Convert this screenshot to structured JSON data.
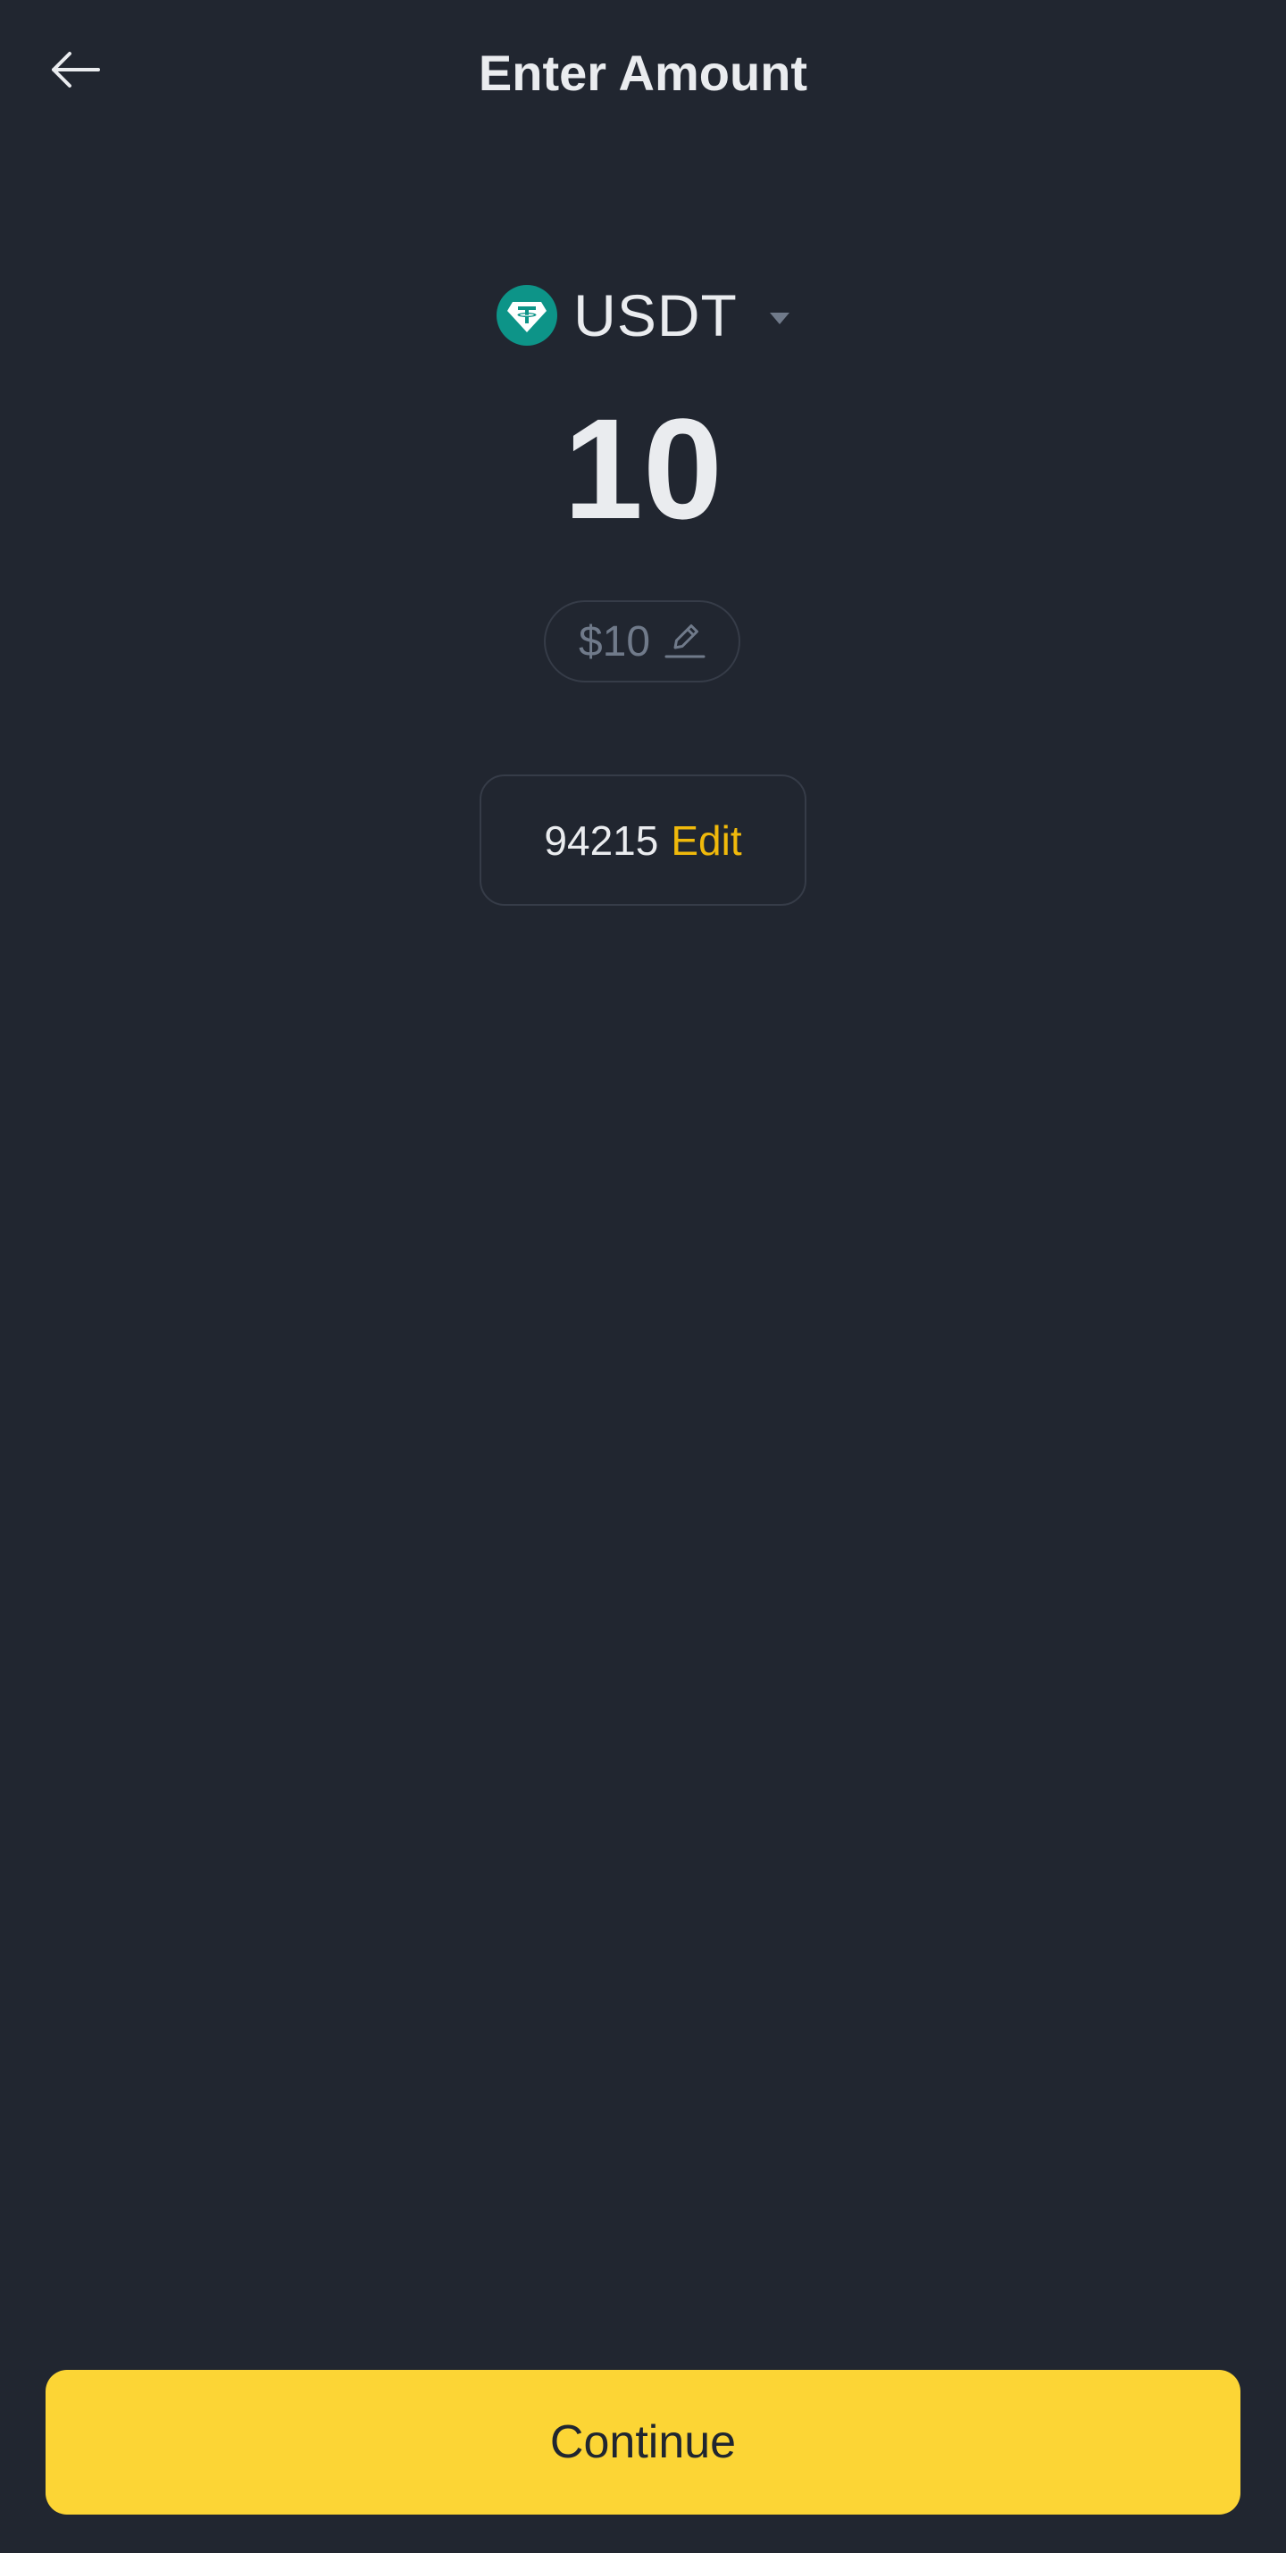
{
  "header": {
    "title": "Enter Amount",
    "back_icon": "arrow-left-icon"
  },
  "coin": {
    "symbol": "USDT",
    "icon": "tether-icon",
    "icon_color": "#0d9488"
  },
  "amount": {
    "value": "10",
    "fiat_value": "$10",
    "fiat_edit_icon": "pencil-icon"
  },
  "note": {
    "value": "94215",
    "edit_label": "Edit"
  },
  "footer": {
    "continue_label": "Continue"
  },
  "colors": {
    "background": "#212630",
    "text_primary": "#eaecef",
    "text_secondary": "#707a8a",
    "accent_yellow": "#fcd535",
    "link_yellow": "#f0b90b",
    "border": "#363c48"
  }
}
